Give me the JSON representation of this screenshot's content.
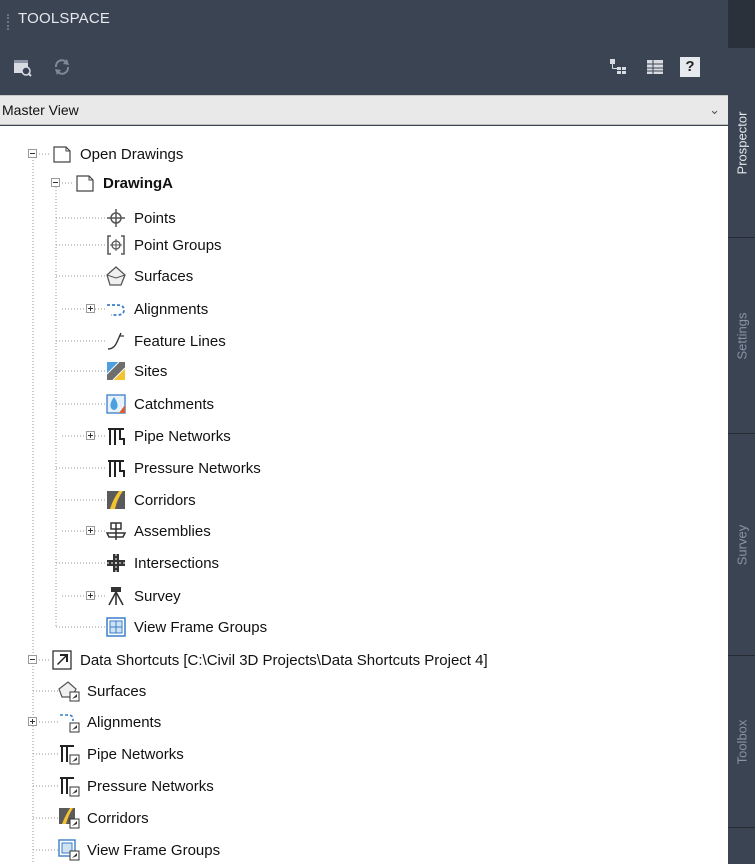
{
  "window": {
    "title": "TOOLSPACE"
  },
  "toolbar": {
    "buttons": [
      {
        "icon": "item-view-icon"
      },
      {
        "icon": "refresh-icon"
      },
      {
        "icon": "tree-toggle-icon"
      },
      {
        "icon": "list-view-icon"
      },
      {
        "icon": "help-icon",
        "label": "?"
      }
    ]
  },
  "view_selector": {
    "value": "Master View"
  },
  "tree": {
    "open_drawings": {
      "label": "Open Drawings",
      "drawing": {
        "label": "DrawingA",
        "items": [
          {
            "label": "Points",
            "icon": "points-icon",
            "expandable": false
          },
          {
            "label": "Point Groups",
            "icon": "point-groups-icon",
            "expandable": false
          },
          {
            "label": "Surfaces",
            "icon": "surfaces-icon",
            "expandable": false
          },
          {
            "label": "Alignments",
            "icon": "alignments-icon",
            "expandable": true
          },
          {
            "label": "Feature Lines",
            "icon": "feature-lines-icon",
            "expandable": false
          },
          {
            "label": "Sites",
            "icon": "sites-icon",
            "expandable": false
          },
          {
            "label": "Catchments",
            "icon": "catchments-icon",
            "expandable": false
          },
          {
            "label": "Pipe Networks",
            "icon": "pipe-networks-icon",
            "expandable": true
          },
          {
            "label": "Pressure Networks",
            "icon": "pressure-networks-icon",
            "expandable": false
          },
          {
            "label": "Corridors",
            "icon": "corridors-icon",
            "expandable": false
          },
          {
            "label": "Assemblies",
            "icon": "assemblies-icon",
            "expandable": true
          },
          {
            "label": "Intersections",
            "icon": "intersections-icon",
            "expandable": false
          },
          {
            "label": "Survey",
            "icon": "survey-icon",
            "expandable": true
          },
          {
            "label": "View Frame Groups",
            "icon": "view-frame-groups-icon",
            "expandable": false
          }
        ]
      }
    },
    "data_shortcuts": {
      "label": "Data Shortcuts [C:\\Civil 3D Projects\\Data Shortcuts Project 4]",
      "items": [
        {
          "label": "Surfaces",
          "icon": "surfaces-shortcut-icon",
          "expandable": false
        },
        {
          "label": "Alignments",
          "icon": "alignments-shortcut-icon",
          "expandable": true
        },
        {
          "label": "Pipe Networks",
          "icon": "pipe-networks-shortcut-icon",
          "expandable": false
        },
        {
          "label": "Pressure Networks",
          "icon": "pressure-networks-shortcut-icon",
          "expandable": false
        },
        {
          "label": "Corridors",
          "icon": "corridors-shortcut-icon",
          "expandable": false
        },
        {
          "label": "View Frame Groups",
          "icon": "view-frame-groups-shortcut-icon",
          "expandable": false
        }
      ]
    }
  },
  "side_tabs": [
    {
      "label": "Prospector",
      "active": true
    },
    {
      "label": "Settings",
      "active": false
    },
    {
      "label": "Survey",
      "active": false
    },
    {
      "label": "Toolbox",
      "active": false
    }
  ],
  "colors": {
    "frame": "#3b4453",
    "tab_active_text": "#e6e9ee",
    "tab_inactive_text": "#8a93a3"
  }
}
